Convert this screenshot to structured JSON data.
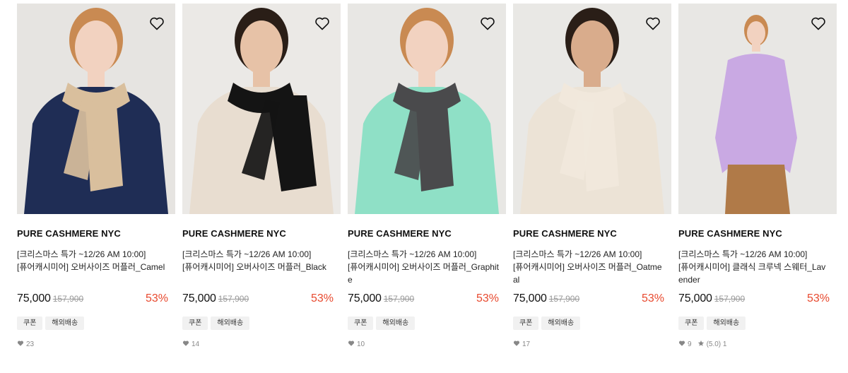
{
  "products": [
    {
      "brand": "PURE CASHMERE NYC",
      "title_line1": "[크리스마스 특가 ~12/26 AM 10:00]",
      "title_line2": "[퓨어캐시미어] 오버사이즈 머플러_Camel",
      "price": "75,000",
      "original_price": "157,900",
      "discount": "53%",
      "badges": [
        "쿠폰",
        "해외배송"
      ],
      "likes": "23",
      "rating": "",
      "reviews": "",
      "colors": {
        "bg": "#e6e4e1",
        "top": "#1f2d55",
        "scarf": "#d9bf9d",
        "skin": "#f2d2c0",
        "hair": "#c98a52"
      }
    },
    {
      "brand": "PURE CASHMERE NYC",
      "title_line1": "[크리스마스 특가 ~12/26 AM 10:00]",
      "title_line2": "[퓨어캐시미어] 오버사이즈 머플러_Black",
      "price": "75,000",
      "original_price": "157,900",
      "discount": "53%",
      "badges": [
        "쿠폰",
        "해외배송"
      ],
      "likes": "14",
      "rating": "",
      "reviews": "",
      "colors": {
        "bg": "#ebe9e6",
        "top": "#e8ddd0",
        "scarf": "#141414",
        "skin": "#e7c2a7",
        "hair": "#2a1e17"
      }
    },
    {
      "brand": "PURE CASHMERE NYC",
      "title_line1": "[크리스마스 특가 ~12/26 AM 10:00]",
      "title_line2": "[퓨어캐시미어] 오버사이즈 머플러_Graphite",
      "price": "75,000",
      "original_price": "157,900",
      "discount": "53%",
      "badges": [
        "쿠폰",
        "해외배송"
      ],
      "likes": "10",
      "rating": "",
      "reviews": "",
      "colors": {
        "bg": "#e8e7e4",
        "top": "#8fe0c6",
        "scarf": "#4a4a4c",
        "skin": "#f2d2c0",
        "hair": "#c98a52"
      }
    },
    {
      "brand": "PURE CASHMERE NYC",
      "title_line1": "[크리스마스 특가 ~12/26 AM 10:00]",
      "title_line2": "[퓨어캐시미어] 오버사이즈 머플러_Oatmeal",
      "price": "75,000",
      "original_price": "157,900",
      "discount": "53%",
      "badges": [
        "쿠폰",
        "해외배송"
      ],
      "likes": "17",
      "rating": "",
      "reviews": "",
      "colors": {
        "bg": "#e9e8e5",
        "top": "#ece3d6",
        "scarf": "#f1e8dc",
        "skin": "#d9ac8c",
        "hair": "#2a1e17"
      }
    },
    {
      "brand": "PURE CASHMERE NYC",
      "title_line1": "[크리스마스 특가 ~12/26 AM 10:00]",
      "title_line2": "[퓨어캐시미어] 클래식 크루넥 스웨터_Lavender",
      "price": "75,000",
      "original_price": "157,900",
      "discount": "53%",
      "badges": [
        "쿠폰",
        "해외배송"
      ],
      "likes": "9",
      "rating": "(5.0)",
      "reviews": "1",
      "colors": {
        "bg": "#e8e7e4",
        "top": "#c9a9e3",
        "scarf": "",
        "skin": "#f2d2c0",
        "hair": "#c98a52",
        "pants": "#b07a48"
      }
    }
  ]
}
